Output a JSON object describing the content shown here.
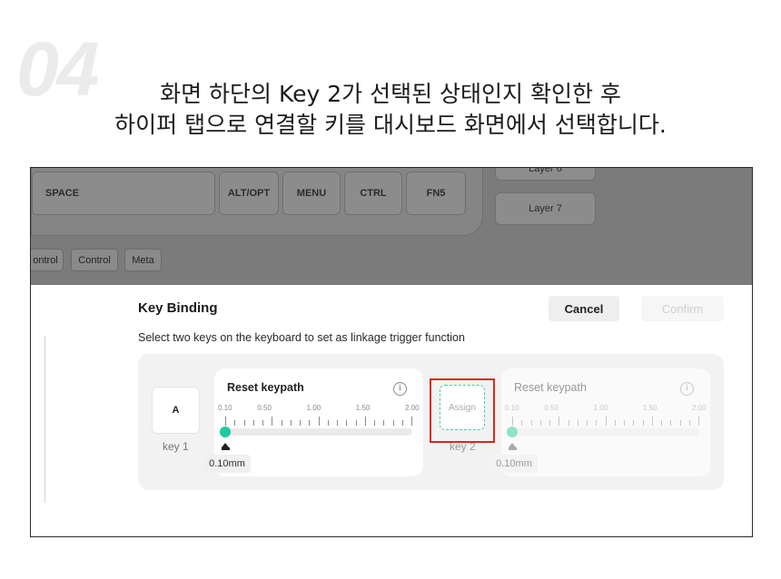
{
  "step_number": "04",
  "heading_line1": "화면 하단의 Key 2가 선택된 상태인지 확인한 후",
  "heading_line2": "하이퍼 탭으로 연결할 키를 대시보드 화면에서 선택합니다.",
  "keyboard_bg": {
    "keys": [
      "SPACE",
      "ALT/OPT",
      "MENU",
      "CTRL",
      "FN5"
    ],
    "layers": [
      "Layer 6",
      "Layer 7"
    ],
    "modifiers": [
      "ontrol",
      "Control",
      "Meta"
    ]
  },
  "dialog": {
    "title": "Key Binding",
    "subtitle": "Select two keys on the keyboard to set as linkage trigger function",
    "cancel_label": "Cancel",
    "confirm_label": "Confirm"
  },
  "key1": {
    "keycap": "A",
    "label": "key 1",
    "card_title": "Reset keypath",
    "info_icon": "i",
    "scale": [
      "0.10",
      "0.50",
      "1.00",
      "1.50",
      "2.00"
    ],
    "value": "0.10mm",
    "travel_mm": 0.1
  },
  "key2": {
    "keycap": "Assign",
    "label": "key 2",
    "card_title": "Reset keypath",
    "info_icon": "i",
    "scale": [
      "0.10",
      "0.50",
      "1.00",
      "1.50",
      "2.00"
    ],
    "value": "0.10mm",
    "travel_mm": 0.1
  },
  "colors": {
    "accent": "#1ccca0",
    "highlight": "#e2231a",
    "overlay": "#7b7b7b"
  }
}
